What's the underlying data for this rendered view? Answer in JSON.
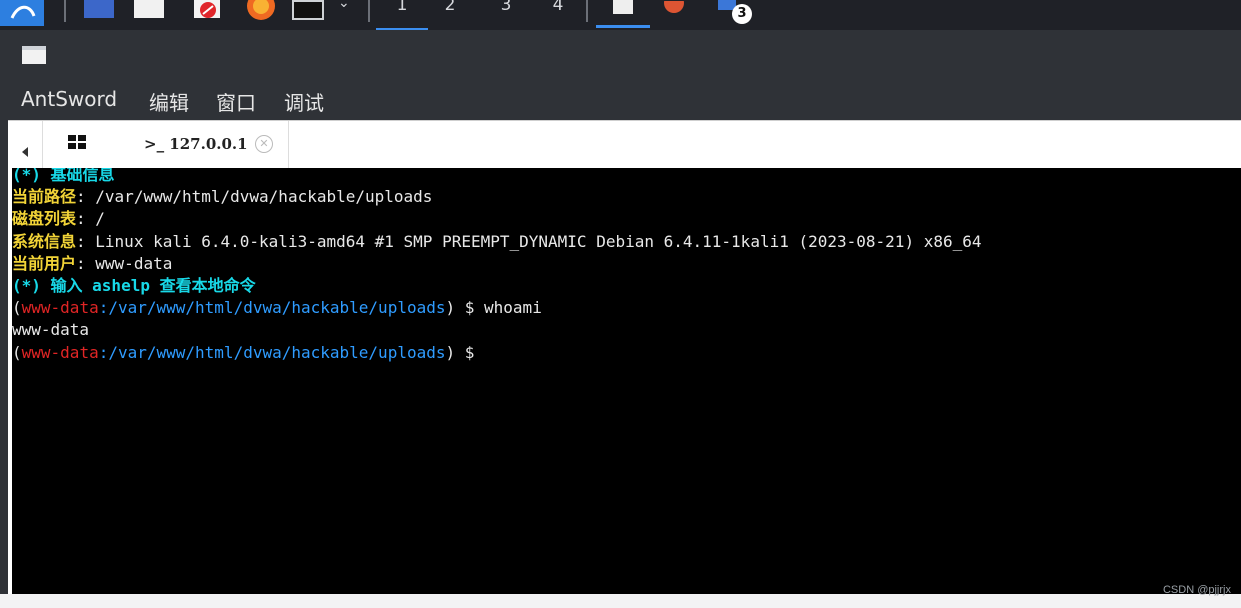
{
  "taskbar": {
    "workspaces": [
      "1",
      "2",
      "3",
      "4"
    ],
    "badge": "3",
    "icons": [
      "kali-menu-icon",
      "files-icon",
      "text-editor-icon",
      "screenshot-icon",
      "firefox-icon",
      "terminal-icon"
    ]
  },
  "menubar": {
    "items": [
      "AntSword",
      "编辑",
      "窗口",
      "调试"
    ]
  },
  "tabs": {
    "terminal_tab_label": ">_ 127.0.0.1"
  },
  "terminal": {
    "line1": "(*) 基础信息",
    "line2_label": "当前路径",
    "line2_value": ": /var/www/html/dvwa/hackable/uploads",
    "line3_label": "磁盘列表",
    "line3_value": ": /",
    "line4_label": "系统信息",
    "line4_value": ": Linux kali 6.4.0-kali3-amd64 #1 SMP PREEMPT_DYNAMIC Debian 6.4.11-1kali1 (2023-08-21) x86_64",
    "line5_label": "当前用户",
    "line5_value": ": www-data",
    "line6": "(*) 输入 ashelp 查看本地命令",
    "prompt_open": "(",
    "prompt_user": "www-data",
    "prompt_path": ":/var/www/html/dvwa/hackable/uploads",
    "prompt_close": ") $",
    "cmd1": " whoami",
    "output1": "www-data"
  },
  "watermark": "CSDN @pjjrjx"
}
